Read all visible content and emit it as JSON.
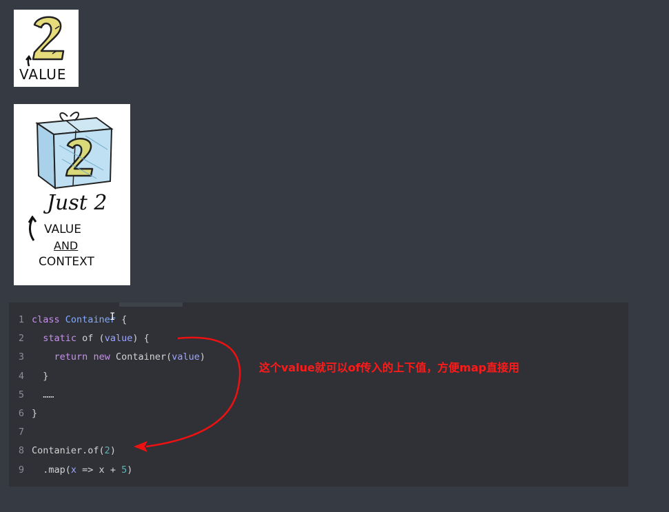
{
  "illustrations": {
    "value_card": {
      "numeral": "2",
      "caption": "VALUE"
    },
    "context_card": {
      "numeral": "2",
      "title": "Just 2",
      "caption_line1": "VALUE",
      "caption_line2": "AND",
      "caption_line3": "CONTEXT"
    }
  },
  "code": {
    "lines": [
      {
        "no": "1",
        "tokens": [
          [
            "kw",
            "class"
          ],
          [
            "plain",
            " "
          ],
          [
            "cls",
            "Container"
          ],
          [
            "plain",
            " {"
          ]
        ]
      },
      {
        "no": "2",
        "tokens": [
          [
            "plain",
            "  "
          ],
          [
            "kw",
            "static"
          ],
          [
            "plain",
            " of ("
          ],
          [
            "param",
            "value"
          ],
          [
            "plain",
            ") {"
          ]
        ]
      },
      {
        "no": "3",
        "tokens": [
          [
            "plain",
            "    "
          ],
          [
            "kw",
            "return"
          ],
          [
            "plain",
            " "
          ],
          [
            "kw",
            "new"
          ],
          [
            "plain",
            " Container("
          ],
          [
            "param",
            "value"
          ],
          [
            "plain",
            ")"
          ]
        ]
      },
      {
        "no": "4",
        "tokens": [
          [
            "plain",
            "  }"
          ]
        ]
      },
      {
        "no": "5",
        "tokens": [
          [
            "plain",
            "  ……"
          ]
        ]
      },
      {
        "no": "6",
        "tokens": [
          [
            "plain",
            "}"
          ]
        ]
      },
      {
        "no": "7",
        "tokens": []
      },
      {
        "no": "8",
        "tokens": [
          [
            "plain",
            "Contanier.of("
          ],
          [
            "num",
            "2"
          ],
          [
            "plain",
            ")"
          ]
        ]
      },
      {
        "no": "9",
        "tokens": [
          [
            "plain",
            "  .map("
          ],
          [
            "param",
            "x"
          ],
          [
            "plain",
            " => x + "
          ],
          [
            "num",
            "5"
          ],
          [
            "plain",
            ")"
          ]
        ]
      }
    ]
  },
  "annotation": {
    "text": "这个value就可以of传入的上下值，方便map直接用",
    "color": "#ff1a1a"
  },
  "colors": {
    "background": "#363a42",
    "code_background": "#2f3136",
    "keyword": "#c792ea",
    "class_name": "#82aaff",
    "number": "#5fb3b3",
    "arrow": "#ee1111"
  }
}
